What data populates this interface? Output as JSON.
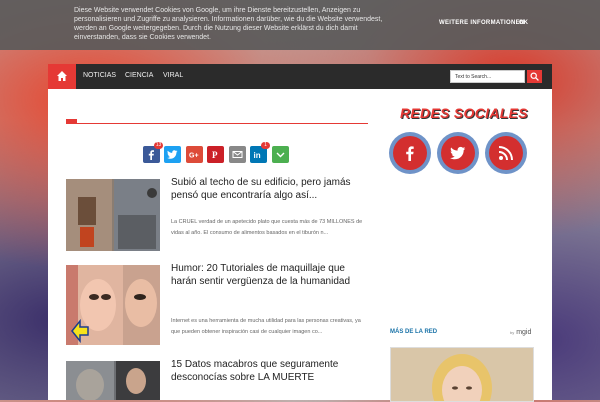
{
  "cookie": {
    "text": "Diese Website verwendet Cookies von Google, um ihre Dienste bereitzustellen, Anzeigen zu personalisieren und Zugriffe zu analysieren. Informationen darüber, wie du die Website verwendest, werden an Google weitergegeben. Durch die Nutzung dieser Website erklärst du dich damit einverstanden, dass sie Cookies verwendet.",
    "more_label": "WEITERE INFORMATIONEN",
    "ok_label": "OK"
  },
  "nav": {
    "items": [
      "NOTICIAS",
      "CIENCIA",
      "VIRAL"
    ],
    "search_placeholder": "Text to Search..."
  },
  "share": {
    "facebook_count": "13",
    "linkedin_count": "1"
  },
  "posts": [
    {
      "title": "Subió al techo de su edificio, pero jamás pensó que encontraría algo así...",
      "excerpt": "La CRUEL verdad de un apetecido plato que cuesta más de 73 MILLONES de vidas al año. El consumo de alimentos basados en el tiburón n..."
    },
    {
      "title": "Humor: 20 Tutoriales de maquillaje que harán sentir vergüenza de la humanidad",
      "excerpt": "Internet es una herramienta de mucha utilidad para las personas creativas, ya que pueden obtener inspiración casi de cualquier imagen co..."
    },
    {
      "title": "15 Datos macabros que seguramente desconocías sobre LA MUERTE",
      "excerpt": ""
    }
  ],
  "sidebar": {
    "social_title": "REDES SOCIALES",
    "more_label": "MÁS DE LA RED",
    "by_label": "by",
    "mgid_label": "mgid"
  },
  "colors": {
    "accent": "#e53935",
    "nav_bg": "#2b2b2b",
    "social_ring": "#6f93c8"
  }
}
